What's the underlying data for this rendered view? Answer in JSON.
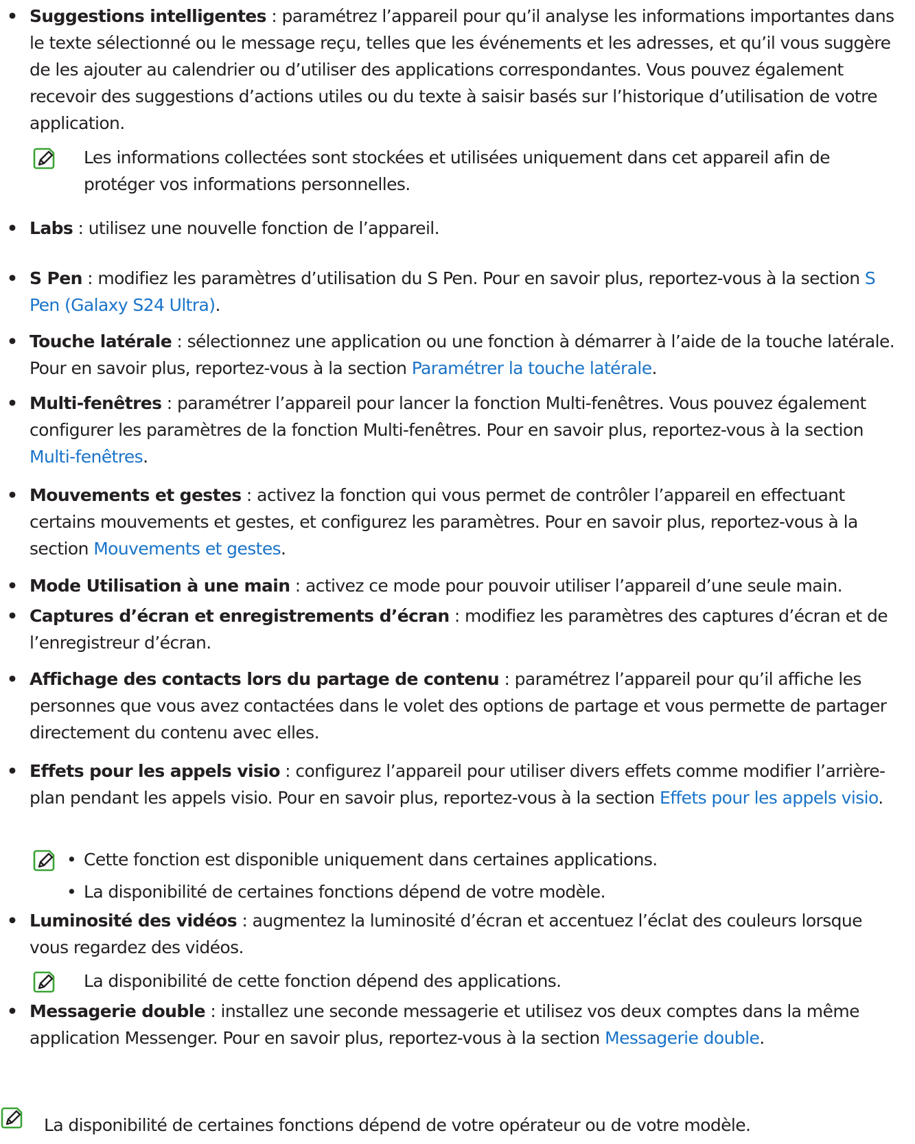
{
  "items": [
    {
      "term": "Suggestions intelligentes",
      "text": " : paramétrez l’appareil pour qu’il analyse les informations importantes dans le texte sélectionné ou le message reçu, telles que les événements et les adresses, et qu’il vous suggère de les ajouter au calendrier ou d’utiliser des applications correspondantes. Vous pouvez également recevoir des suggestions d’actions utiles ou du texte à saisir basés sur l’historique d’utilisation de votre application.",
      "note": "Les informations collectées sont stockées et utilisées uniquement dans cet appareil afin de protéger vos informations personnelles."
    },
    {
      "term": "Labs",
      "text": " : utilisez une nouvelle fonction de l’appareil."
    },
    {
      "term": "S Pen",
      "text": " : modifiez les paramètres d’utilisation du S Pen. Pour en savoir plus, reportez-vous à la section ",
      "link": "S Pen (Galaxy S24 Ultra)",
      "after": "."
    },
    {
      "term": "Touche latérale",
      "text": " : sélectionnez une application ou une fonction à démarrer à l’aide de la touche latérale. Pour en savoir plus, reportez-vous à la section ",
      "link": "Paramétrer la touche latérale",
      "after": "."
    },
    {
      "term": "Multi-fenêtres",
      "text": " : paramétrer l’appareil pour lancer la fonction Multi-fenêtres. Vous pouvez également configurer les paramètres de la fonction Multi-fenêtres. Pour en savoir plus, reportez-vous à la section ",
      "link": "Multi-fenêtres",
      "after": "."
    },
    {
      "term": "Mouvements et gestes",
      "text": " : activez la fonction qui vous permet de contrôler l’appareil en effectuant certains mouvements et gestes, et configurez les paramètres. Pour en savoir plus, reportez-vous à la section ",
      "link": "Mouvements et gestes",
      "after": "."
    },
    {
      "term": "Mode Utilisation à une main",
      "text": " : activez ce mode pour pouvoir utiliser l’appareil d’une seule main."
    },
    {
      "term": "Captures d’écran et enregistrements d’écran",
      "text": " : modifiez les paramètres des captures d’écran et de l’enregistreur d’écran."
    },
    {
      "term": "Affichage des contacts lors du partage de contenu",
      "text": " : paramétrez l’appareil pour qu’il affiche les personnes que vous avez contactées dans le volet des options de partage et vous permette de partager directement du contenu avec elles."
    },
    {
      "term": "Effets pour les appels visio",
      "text": " : configurez l’appareil pour utiliser divers effets comme modifier l’arrière-plan pendant les appels visio. Pour en savoir plus, reportez-vous à la section ",
      "link": "Effets pour les appels visio",
      "after": ".",
      "note_list": [
        "Cette fonction est disponible uniquement dans certaines applications.",
        "La disponibilité de certaines fonctions dépend de votre modèle."
      ]
    },
    {
      "term": "Luminosité des vidéos",
      "text": " : augmentez la luminosité d’écran et accentuez l’éclat des couleurs lorsque vous regardez des vidéos.",
      "note": "La disponibilité de cette fonction dépend des applications."
    },
    {
      "term": "Messagerie double",
      "text": " : installez une seconde messagerie et utilisez vos deux comptes dans la même application Messenger. Pour en savoir plus, reportez-vous à la section ",
      "link": "Messagerie double",
      "after": "."
    }
  ],
  "footer_note": "La disponibilité de certaines fonctions dépend de votre opérateur ou de votre modèle.",
  "bullet": "•",
  "icon": "note-pencil-icon",
  "colors": {
    "link": "#1a74c9",
    "note_icon": "#3aa335",
    "text": "#231f20"
  }
}
